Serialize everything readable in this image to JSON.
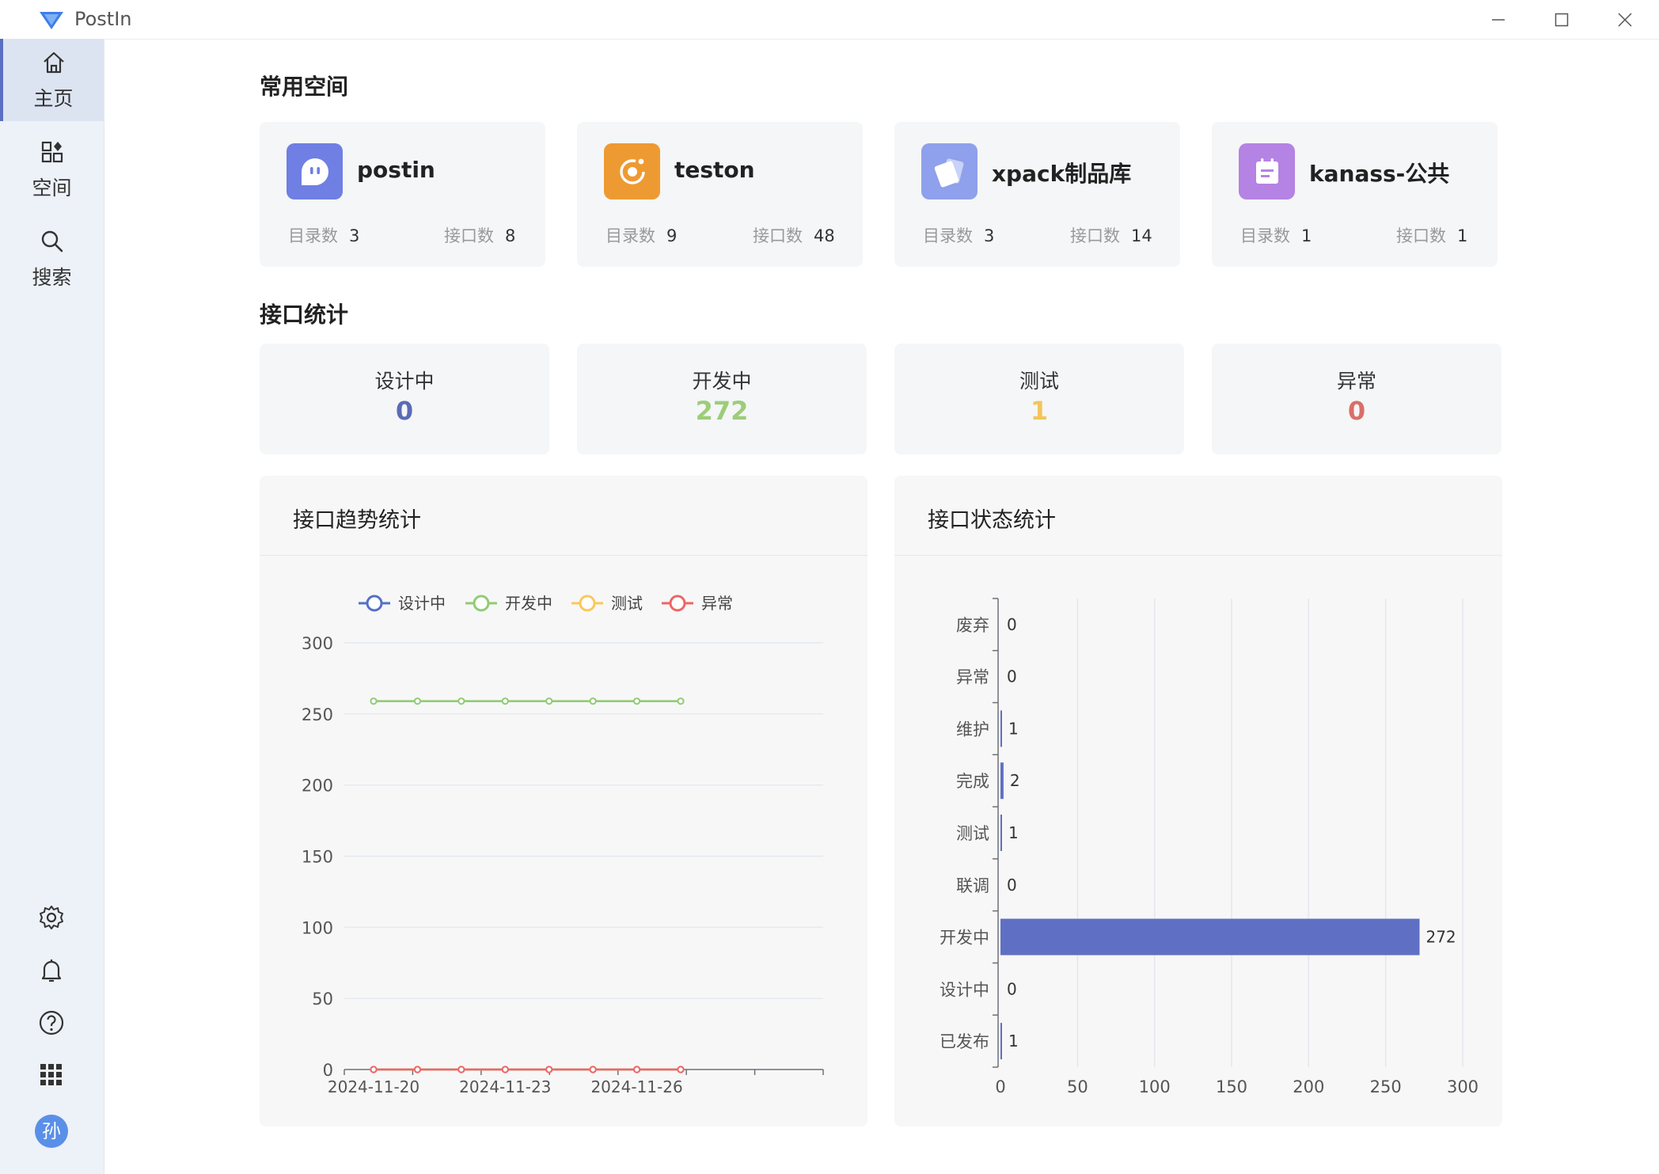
{
  "window": {
    "title": "PostIn"
  },
  "nav": {
    "items": [
      {
        "label": "主页",
        "icon": "home-icon"
      },
      {
        "label": "空间",
        "icon": "grid-plus-icon"
      },
      {
        "label": "搜索",
        "icon": "search-icon"
      }
    ],
    "avatar": "孙"
  },
  "spaces": {
    "title": "常用空间",
    "dir_label": "目录数",
    "api_label": "接口数",
    "items": [
      {
        "name": "postin",
        "dirs": "3",
        "apis": "8",
        "color": "#6f7fe3",
        "icon": "robot-icon"
      },
      {
        "name": "teston",
        "dirs": "9",
        "apis": "48",
        "color": "#ee9a33",
        "icon": "orbit-icon"
      },
      {
        "name": "xpack制品库",
        "dirs": "3",
        "apis": "14",
        "color": "#8fa0ec",
        "icon": "cards-icon"
      },
      {
        "name": "kanass-公共",
        "dirs": "1",
        "apis": "1",
        "color": "#b583e3",
        "icon": "calendar-icon"
      }
    ]
  },
  "stats": {
    "title": "接口统计",
    "items": [
      {
        "label": "设计中",
        "value": "0",
        "color": "#5a6bb5"
      },
      {
        "label": "开发中",
        "value": "272",
        "color": "#9ccd79"
      },
      {
        "label": "测试",
        "value": "1",
        "color": "#f2c55c"
      },
      {
        "label": "异常",
        "value": "0",
        "color": "#d96f68"
      }
    ]
  },
  "trend": {
    "title": "接口趋势统计"
  },
  "status": {
    "title": "接口状态统计"
  },
  "chart_data": [
    {
      "type": "line",
      "title": "接口趋势统计",
      "x": [
        "2024-11-20",
        "2024-11-21",
        "2024-11-22",
        "2024-11-23",
        "2024-11-24",
        "2024-11-25",
        "2024-11-26",
        "2024-11-27"
      ],
      "x_tick_labels": [
        "2024-11-20",
        "2024-11-23",
        "2024-11-26"
      ],
      "ylim": [
        0,
        300
      ],
      "y_ticks": [
        0,
        50,
        100,
        150,
        200,
        250,
        300
      ],
      "legend_position": "top",
      "series": [
        {
          "name": "设计中",
          "color": "#5470c6",
          "values": [
            0,
            0,
            0,
            0,
            0,
            0,
            0,
            0
          ]
        },
        {
          "name": "开发中",
          "color": "#91cc75",
          "values": [
            259,
            259,
            259,
            259,
            259,
            259,
            259,
            259
          ]
        },
        {
          "name": "测试",
          "color": "#fac858",
          "values": [
            0,
            0,
            0,
            0,
            0,
            0,
            0,
            0
          ]
        },
        {
          "name": "异常",
          "color": "#ee6666",
          "values": [
            0,
            0,
            0,
            0,
            0,
            0,
            0,
            0
          ]
        }
      ]
    },
    {
      "type": "bar",
      "orientation": "horizontal",
      "title": "接口状态统计",
      "categories": [
        "废弃",
        "异常",
        "维护",
        "完成",
        "测试",
        "联调",
        "开发中",
        "设计中",
        "已发布"
      ],
      "values": [
        0,
        0,
        1,
        2,
        1,
        0,
        272,
        0,
        1
      ],
      "xlim": [
        0,
        300
      ],
      "x_ticks": [
        0,
        50,
        100,
        150,
        200,
        250,
        300
      ],
      "color": "#5f6fc4"
    }
  ]
}
